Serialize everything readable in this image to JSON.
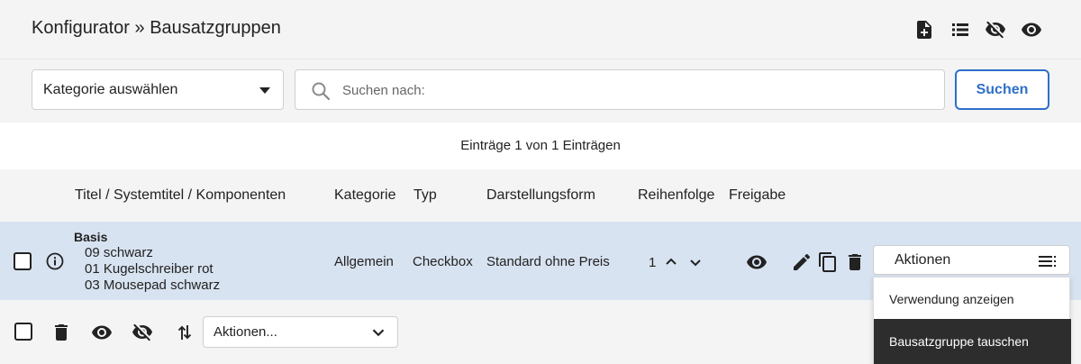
{
  "header": {
    "title": "Konfigurator » Bausatzgruppen",
    "icons": [
      "add-document-icon",
      "list-icon",
      "eye-off-icon",
      "eye-icon"
    ]
  },
  "filters": {
    "category_select": "Kategorie auswählen",
    "search_placeholder": "Suchen nach:",
    "search_button": "Suchen"
  },
  "entries_info": "Einträge 1 von 1 Einträgen",
  "table": {
    "columns": [
      "Titel / Systemtitel / Komponenten",
      "Kategorie",
      "Typ",
      "Darstellungsform",
      "Reihenfolge",
      "Freigabe"
    ],
    "rows": [
      {
        "title": "Basis",
        "components": [
          "09 schwarz",
          "01 Kugelschreiber rot",
          "03 Mousepad schwarz"
        ],
        "category": "Allgemein",
        "type": "Checkbox",
        "display_form": "Standard ohne Preis",
        "order": "1",
        "actions_label": "Aktionen"
      }
    ]
  },
  "actions_menu": {
    "items": [
      "Verwendung anzeigen",
      "Bausatzgruppe tauschen"
    ],
    "highlighted_index": 1
  },
  "footer": {
    "bulk_actions_select": "Aktionen..."
  },
  "colors": {
    "row_highlight": "#d8e3f1",
    "accent_blue": "#2f6fc8",
    "menu_highlight": "#2d2d2d"
  }
}
